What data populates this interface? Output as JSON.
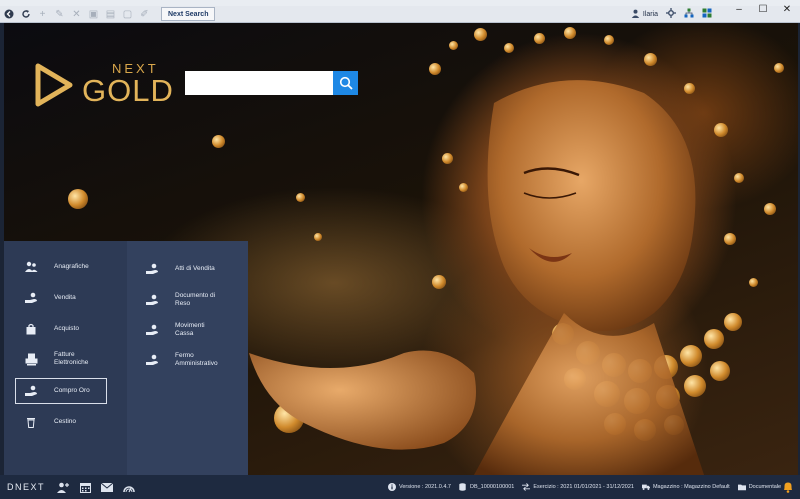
{
  "toolbar": {
    "tab_label": "Next Search",
    "user_name": "Ilaria",
    "buttons": [
      "back-icon",
      "refresh-icon",
      "add-icon",
      "edit-icon",
      "delete-icon",
      "save-icon",
      "save-copy-icon",
      "print-icon",
      "pen-icon"
    ]
  },
  "window_controls": {
    "minimize": "–",
    "maximize": "☐",
    "close": "✕"
  },
  "brand": {
    "next": "NEXT",
    "gold": "GOLD",
    "accent": "#e2b45a"
  },
  "search": {
    "value": "",
    "placeholder": ""
  },
  "menu": {
    "left": [
      {
        "label": "Anagrafiche",
        "icon": "people-icon"
      },
      {
        "label": "Vendita",
        "icon": "hand-coin-icon"
      },
      {
        "label": "Acquisto",
        "icon": "bag-icon"
      },
      {
        "label": "Fatture\nElettroniche",
        "icon": "invoice-printer-icon"
      },
      {
        "label": "Compro Oro",
        "icon": "gold-buy-icon",
        "selected": true
      },
      {
        "label": "Cestino",
        "icon": "trash-icon"
      }
    ],
    "right": [
      {
        "label": "Atti di Vendita",
        "icon": "hand-coin-icon"
      },
      {
        "label": "Documento di\nReso",
        "icon": "hand-coin-icon"
      },
      {
        "label": "Movimenti\nCassa",
        "icon": "hand-coin-icon"
      },
      {
        "label": "Fermo\nAmministrativo",
        "icon": "hand-coin-icon"
      }
    ]
  },
  "status": {
    "logo": "DNEXT",
    "version_label": "Versione : 2021.0.4.7",
    "db_label": "DB_10000100001",
    "esercizio_label": "Esercizio : 2021 01/01/2021 - 31/12/2021",
    "magazzino_label": "Magazzino : Magazzino Default",
    "documentale_label": "Documentale",
    "colors": {
      "bar": "#1e2a40",
      "menu": "#2d3a55",
      "search_button": "#1e88e5"
    }
  }
}
